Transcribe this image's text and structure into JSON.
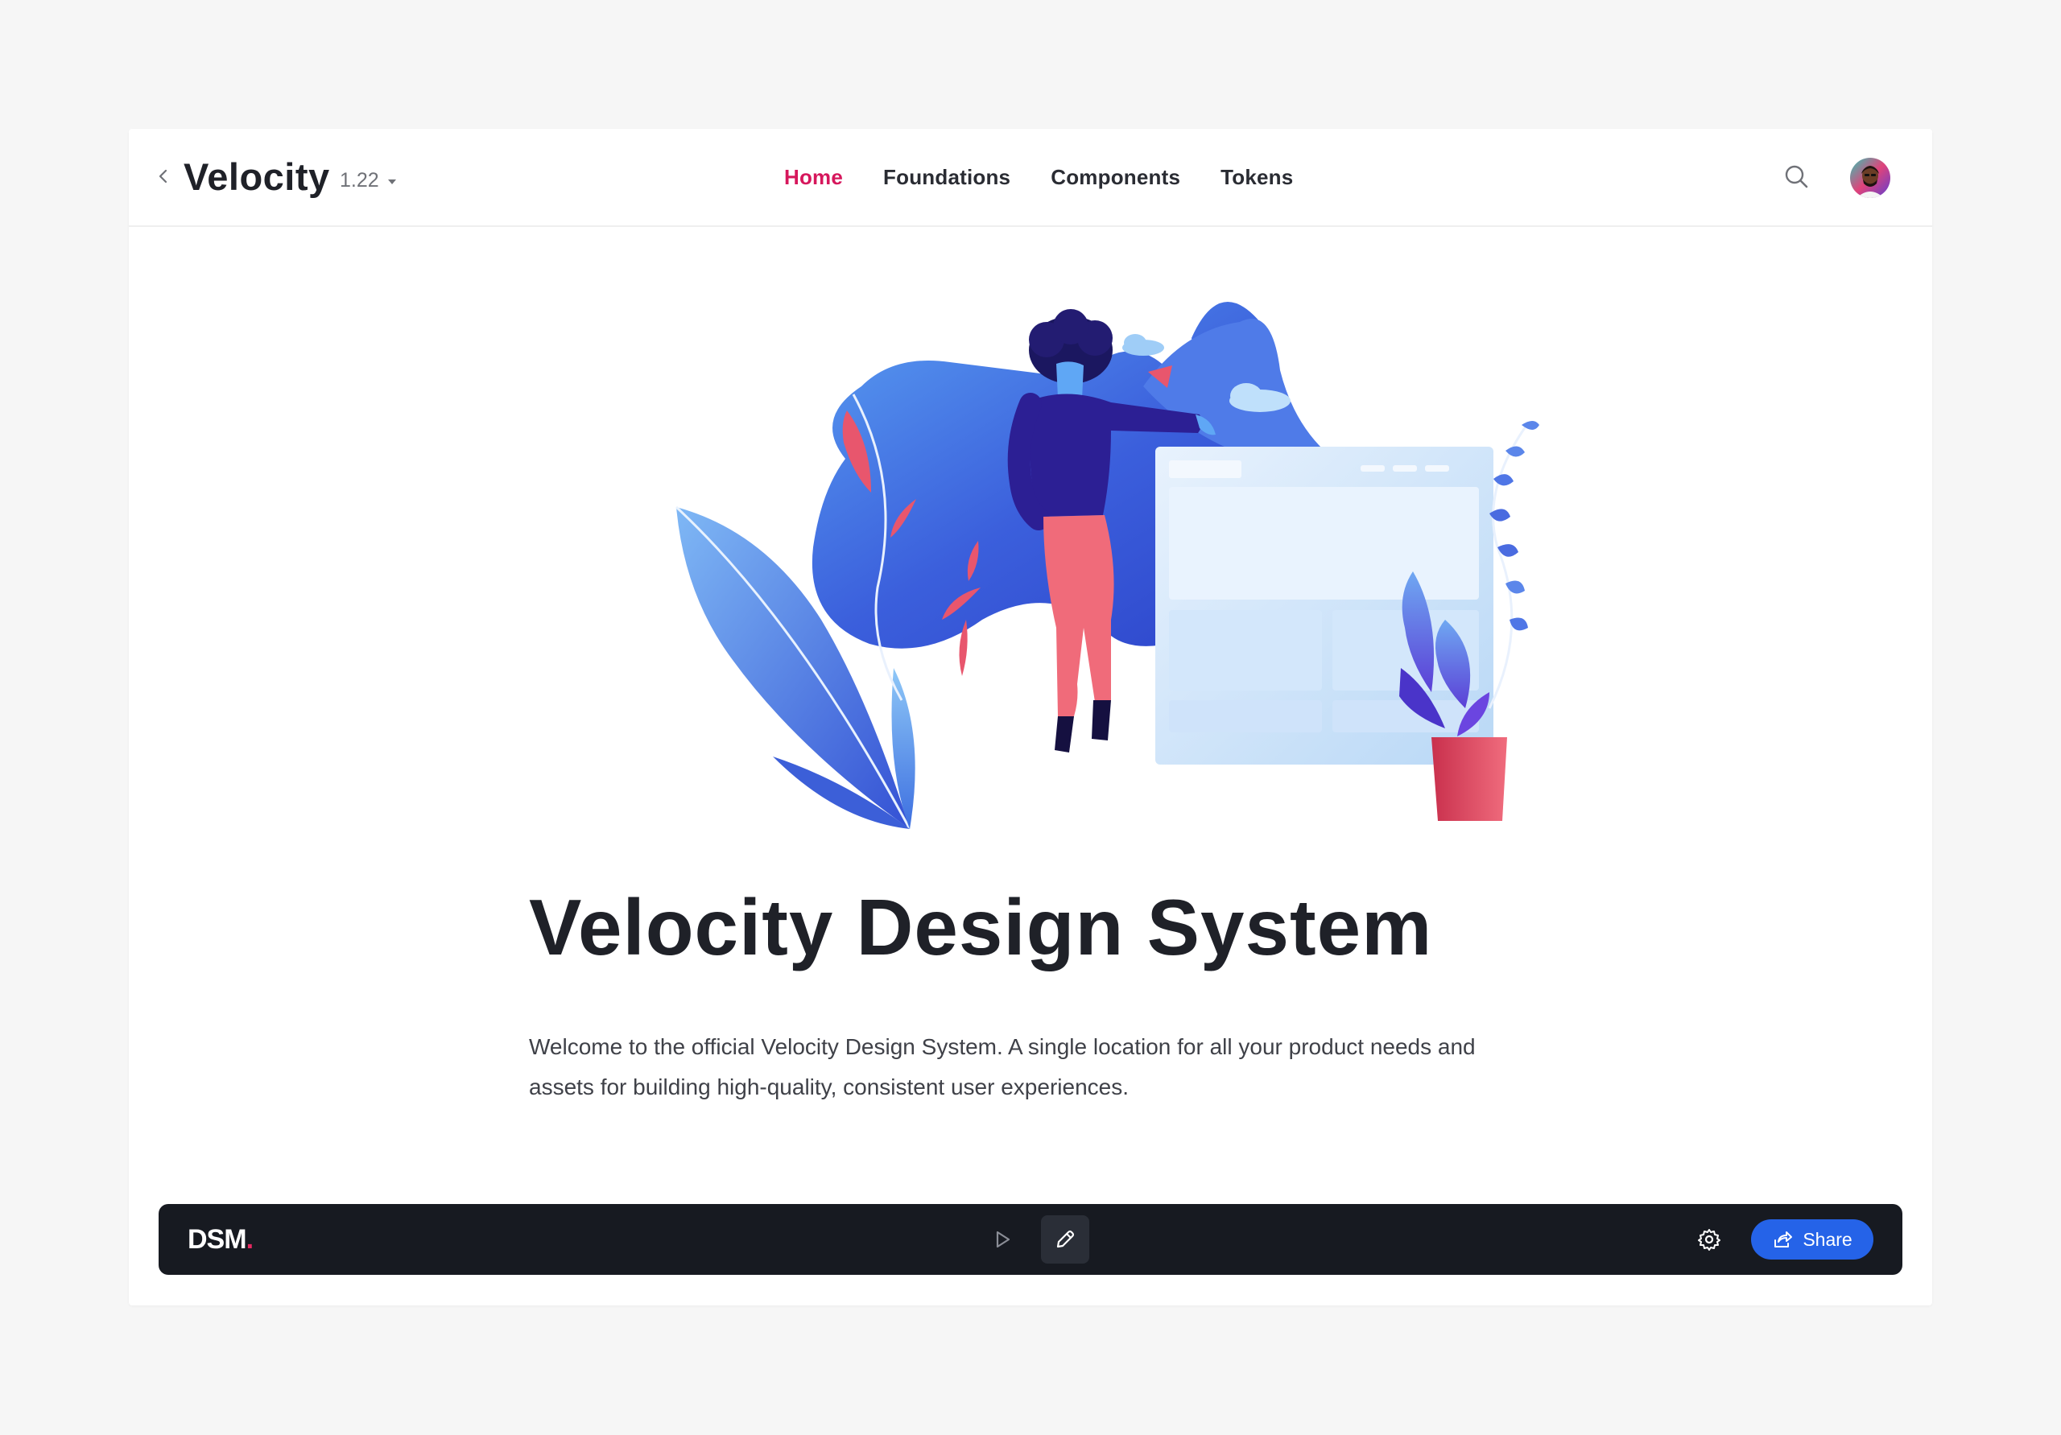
{
  "header": {
    "brand": "Velocity",
    "version": "1.22",
    "nav": [
      {
        "label": "Home",
        "active": true
      },
      {
        "label": "Foundations",
        "active": false
      },
      {
        "label": "Components",
        "active": false
      },
      {
        "label": "Tokens",
        "active": false
      }
    ],
    "icons": {
      "back": "chevron-left-icon",
      "version_caret": "caret-down-icon",
      "search": "search-icon",
      "avatar": "user-avatar"
    }
  },
  "main": {
    "title": "Velocity Design System",
    "description": "Welcome to the official Velocity Design System. A single location for all your product needs and assets for building high-quality, consistent user experiences.",
    "hero_illustration": "person-with-plants-and-browser-illustration"
  },
  "dsm_bar": {
    "logo": "DSM",
    "logo_dot": ".",
    "share_label": "Share",
    "icons": {
      "play": "play-icon",
      "edit": "pencil-icon",
      "settings": "gear-icon",
      "share": "share-arrow-icon"
    }
  },
  "colors": {
    "accent": "#d6175c",
    "share_button": "#2563e8",
    "dsm_bar_bg": "#171a21"
  }
}
